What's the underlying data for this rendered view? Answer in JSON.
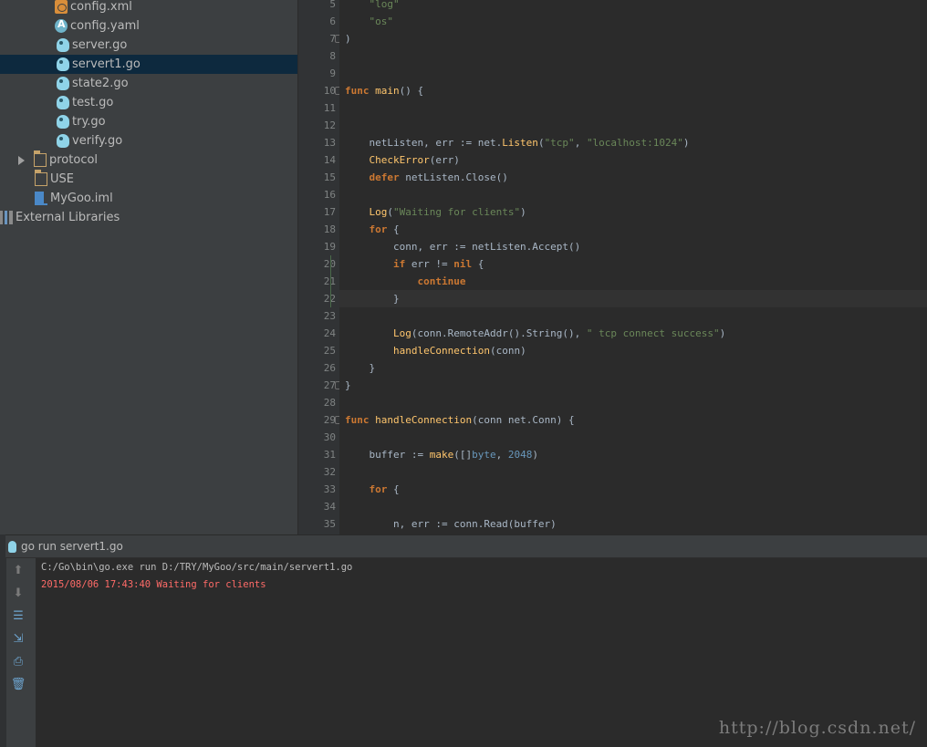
{
  "project_tree": {
    "items": [
      {
        "label": "config.xml",
        "icon": "xml-file-icon",
        "indent": 2
      },
      {
        "label": "config.yaml",
        "icon": "yaml-file-icon",
        "indent": 2
      },
      {
        "label": "server.go",
        "icon": "go-file-icon",
        "indent": 2
      },
      {
        "label": "servert1.go",
        "icon": "go-file-icon",
        "indent": 2,
        "selected": true
      },
      {
        "label": "state2.go",
        "icon": "go-file-icon",
        "indent": 2
      },
      {
        "label": "test.go",
        "icon": "go-file-icon",
        "indent": 2
      },
      {
        "label": "try.go",
        "icon": "go-file-icon",
        "indent": 2
      },
      {
        "label": "verify.go",
        "icon": "go-file-icon",
        "indent": 2
      },
      {
        "label": "protocol",
        "icon": "folder-icon",
        "indent": 1,
        "collapsed": true
      },
      {
        "label": "USE",
        "icon": "folder-icon",
        "indent": 1
      },
      {
        "label": "MyGoo.iml",
        "icon": "iml-file-icon",
        "indent": 1
      },
      {
        "label": "External Libraries",
        "icon": "libraries-icon",
        "indent": 0
      }
    ]
  },
  "editor": {
    "current_line": 22,
    "lines": [
      {
        "n": "5",
        "tokens": [
          {
            "t": "    \"log\"",
            "c": "str"
          }
        ]
      },
      {
        "n": "6",
        "tokens": [
          {
            "t": "    \"os\"",
            "c": "str"
          }
        ]
      },
      {
        "n": "7",
        "tokens": [
          {
            "t": ")",
            "c": "pl"
          }
        ],
        "fold": true
      },
      {
        "n": "8",
        "tokens": []
      },
      {
        "n": "9",
        "tokens": []
      },
      {
        "n": "10",
        "tokens": [
          {
            "t": "func ",
            "c": "kw"
          },
          {
            "t": "main",
            "c": "fn"
          },
          {
            "t": "() {",
            "c": "pl"
          }
        ],
        "fold": true
      },
      {
        "n": "11",
        "tokens": []
      },
      {
        "n": "12",
        "tokens": []
      },
      {
        "n": "13",
        "tokens": [
          {
            "t": "    netListen, err := net.",
            "c": "pl"
          },
          {
            "t": "Listen",
            "c": "fn"
          },
          {
            "t": "(",
            "c": "pl"
          },
          {
            "t": "\"tcp\"",
            "c": "str"
          },
          {
            "t": ", ",
            "c": "pl"
          },
          {
            "t": "\"localhost:1024\"",
            "c": "str"
          },
          {
            "t": ")",
            "c": "pl"
          }
        ]
      },
      {
        "n": "14",
        "tokens": [
          {
            "t": "    ",
            "c": "pl"
          },
          {
            "t": "CheckError",
            "c": "fn"
          },
          {
            "t": "(err)",
            "c": "pl"
          }
        ]
      },
      {
        "n": "15",
        "tokens": [
          {
            "t": "    ",
            "c": "pl"
          },
          {
            "t": "defer",
            "c": "kw"
          },
          {
            "t": " netListen.Close()",
            "c": "pl"
          }
        ]
      },
      {
        "n": "16",
        "tokens": []
      },
      {
        "n": "17",
        "tokens": [
          {
            "t": "    ",
            "c": "pl"
          },
          {
            "t": "Log",
            "c": "fn"
          },
          {
            "t": "(",
            "c": "pl"
          },
          {
            "t": "\"Waiting for clients\"",
            "c": "str"
          },
          {
            "t": ")",
            "c": "pl"
          }
        ]
      },
      {
        "n": "18",
        "tokens": [
          {
            "t": "    ",
            "c": "pl"
          },
          {
            "t": "for",
            "c": "kw"
          },
          {
            "t": " {",
            "c": "pl"
          }
        ]
      },
      {
        "n": "19",
        "tokens": [
          {
            "t": "        conn, err := netListen.Accept()",
            "c": "pl"
          }
        ]
      },
      {
        "n": "20",
        "tokens": [
          {
            "t": "        ",
            "c": "pl"
          },
          {
            "t": "if",
            "c": "kw"
          },
          {
            "t": " err != ",
            "c": "pl"
          },
          {
            "t": "nil",
            "c": "kw"
          },
          {
            "t": " {",
            "c": "pl"
          }
        ]
      },
      {
        "n": "21",
        "tokens": [
          {
            "t": "            ",
            "c": "pl"
          },
          {
            "t": "continue",
            "c": "kw"
          }
        ]
      },
      {
        "n": "22",
        "tokens": [
          {
            "t": "        }",
            "c": "pl"
          }
        ]
      },
      {
        "n": "23",
        "tokens": []
      },
      {
        "n": "24",
        "tokens": [
          {
            "t": "        ",
            "c": "pl"
          },
          {
            "t": "Log",
            "c": "fn"
          },
          {
            "t": "(conn.RemoteAddr().String(), ",
            "c": "pl"
          },
          {
            "t": "\" tcp connect success\"",
            "c": "str"
          },
          {
            "t": ")",
            "c": "pl"
          }
        ]
      },
      {
        "n": "25",
        "tokens": [
          {
            "t": "        ",
            "c": "pl"
          },
          {
            "t": "handleConnection",
            "c": "fn"
          },
          {
            "t": "(conn)",
            "c": "pl"
          }
        ]
      },
      {
        "n": "26",
        "tokens": [
          {
            "t": "    }",
            "c": "pl"
          }
        ]
      },
      {
        "n": "27",
        "tokens": [
          {
            "t": "}",
            "c": "pl"
          }
        ],
        "fold": true
      },
      {
        "n": "28",
        "tokens": []
      },
      {
        "n": "29",
        "tokens": [
          {
            "t": "func ",
            "c": "kw"
          },
          {
            "t": "handleConnection",
            "c": "fn"
          },
          {
            "t": "(conn net.Conn) {",
            "c": "pl"
          }
        ],
        "fold": true
      },
      {
        "n": "30",
        "tokens": []
      },
      {
        "n": "31",
        "tokens": [
          {
            "t": "    buffer := ",
            "c": "pl"
          },
          {
            "t": "make",
            "c": "fn"
          },
          {
            "t": "([]",
            "c": "pl"
          },
          {
            "t": "byte",
            "c": "num"
          },
          {
            "t": ", ",
            "c": "pl"
          },
          {
            "t": "2048",
            "c": "num"
          },
          {
            "t": ")",
            "c": "pl"
          }
        ]
      },
      {
        "n": "32",
        "tokens": []
      },
      {
        "n": "33",
        "tokens": [
          {
            "t": "    ",
            "c": "pl"
          },
          {
            "t": "for",
            "c": "kw"
          },
          {
            "t": " {",
            "c": "pl"
          }
        ]
      },
      {
        "n": "34",
        "tokens": []
      },
      {
        "n": "35",
        "tokens": [
          {
            "t": "        n, err := conn.Read(buffer)",
            "c": "pl"
          }
        ]
      }
    ]
  },
  "run_panel": {
    "tab_label": "go run servert1.go",
    "console_lines": [
      {
        "text": "C:/Go\\bin\\go.exe run D:/TRY/MyGoo/src/main/servert1.go",
        "color": "#bbbbbb"
      },
      {
        "text": "2015/08/06 17:43:40 Waiting for clients",
        "color": "#ff6b68"
      }
    ],
    "toolbar": [
      {
        "name": "up-arrow-icon",
        "glyph": "⬆"
      },
      {
        "name": "down-arrow-icon",
        "glyph": "⬇"
      },
      {
        "name": "soft-wrap-icon",
        "glyph": "☰"
      },
      {
        "name": "scroll-to-end-icon",
        "glyph": "⇲"
      },
      {
        "name": "print-icon",
        "glyph": "⎙"
      },
      {
        "name": "trash-icon",
        "glyph": "🗑"
      }
    ]
  },
  "watermark": "http://blog.csdn.net/",
  "colors": {
    "keyword": "#cc7832",
    "function": "#ffc66d",
    "string": "#6a8759",
    "number": "#6897bb",
    "error_output": "#ff6b68"
  }
}
